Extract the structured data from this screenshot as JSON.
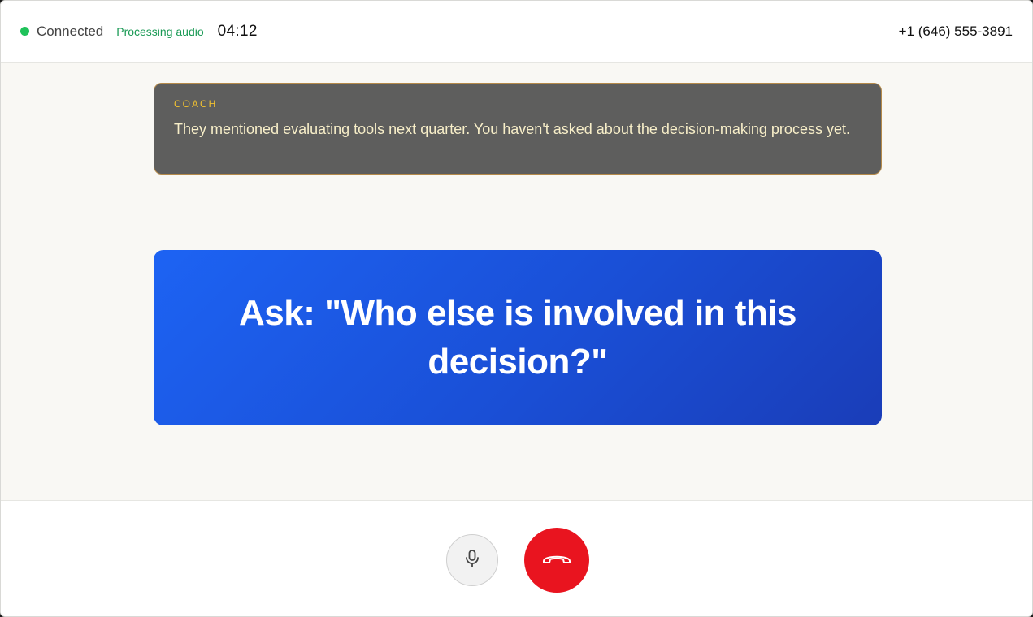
{
  "status": {
    "connection": "Connected",
    "activity": "Processing audio",
    "timer": "04:12",
    "phone_number": "+1 (646) 555-3891",
    "connected_color": "#1fc25a"
  },
  "coach": {
    "label": "COACH",
    "message": "They mentioned evaluating tools next quarter. You haven't asked about the decision-making process yet."
  },
  "prompt": {
    "text": "Ask: \"Who else is involved in this decision?\""
  },
  "controls": {
    "mic_icon": "microphone-icon",
    "hangup_icon": "phone-hangup-icon",
    "hangup_color": "#e9141f"
  }
}
